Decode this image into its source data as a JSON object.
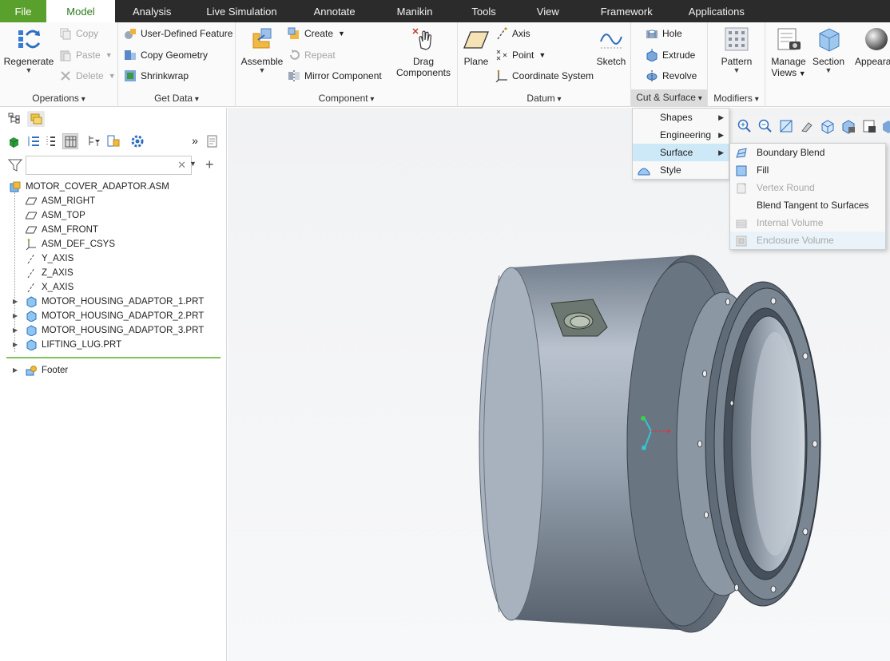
{
  "tabs": [
    "File",
    "Model",
    "Analysis",
    "Live Simulation",
    "Annotate",
    "Manikin",
    "Tools",
    "View",
    "Framework",
    "Applications"
  ],
  "ribbon": {
    "operations": {
      "label": "Operations",
      "regenerate": "Regenerate",
      "copy": "Copy",
      "paste": "Paste",
      "delete": "Delete"
    },
    "get_data": {
      "label": "Get Data",
      "udf": "User-Defined Feature",
      "copy_geometry": "Copy Geometry",
      "shrinkwrap": "Shrinkwrap"
    },
    "component": {
      "label": "Component",
      "assemble": "Assemble",
      "create": "Create",
      "repeat": "Repeat",
      "mirror": "Mirror Component",
      "drag_1": "Drag",
      "drag_2": "Components"
    },
    "datum": {
      "label": "Datum",
      "plane": "Plane",
      "axis": "Axis",
      "point": "Point",
      "csys": "Coordinate System",
      "sketch": "Sketch"
    },
    "cut_surface": {
      "label": "Cut & Surface",
      "hole": "Hole",
      "extrude": "Extrude",
      "revolve": "Revolve"
    },
    "modifiers": {
      "label": "Modifiers",
      "pattern": "Pattern"
    },
    "views": {
      "manage_1": "Manage",
      "manage_2": "Views",
      "section": "Section",
      "appearance": "Appearan"
    }
  },
  "tree": {
    "root": "MOTOR_COVER_ADAPTOR.ASM",
    "items": [
      "ASM_RIGHT",
      "ASM_TOP",
      "ASM_FRONT",
      "ASM_DEF_CSYS",
      "Y_AXIS",
      "Z_AXIS",
      "X_AXIS",
      "MOTOR_HOUSING_ADAPTOR_1.PRT",
      "MOTOR_HOUSING_ADAPTOR_2.PRT",
      "MOTOR_HOUSING_ADAPTOR_3.PRT",
      "LIFTING_LUG.PRT"
    ],
    "footer": "Footer"
  },
  "filter": {
    "value": ""
  },
  "menu_cut_surface": [
    "Shapes",
    "Engineering",
    "Surface",
    "Style"
  ],
  "menu_surface": [
    {
      "label": "Boundary Blend",
      "enabled": true
    },
    {
      "label": "Fill",
      "enabled": true
    },
    {
      "label": "Vertex Round",
      "enabled": false
    },
    {
      "label": "Blend Tangent to Surfaces",
      "enabled": true
    },
    {
      "label": "Internal Volume",
      "enabled": false
    },
    {
      "label": "Enclosure Volume",
      "enabled": false
    }
  ],
  "colors": {
    "file_tab": "#5aa02c",
    "tabbar": "#2b2b2b",
    "model_text": "#2d7a1c",
    "part_body": "#8e9bab",
    "highlight": "#cde8f7"
  }
}
